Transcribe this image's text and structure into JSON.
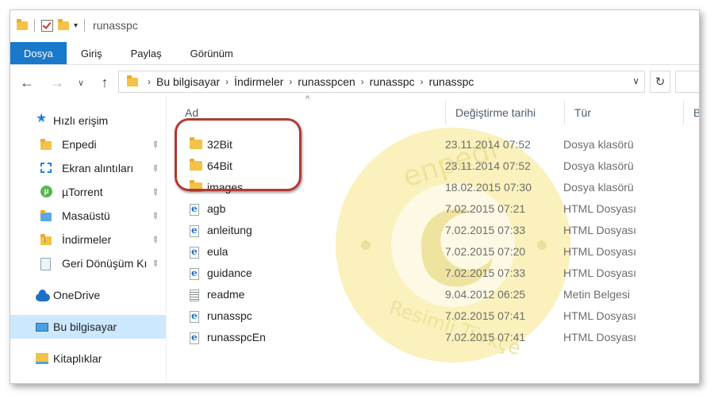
{
  "window": {
    "title": "runasspc",
    "quick_access": {
      "customize_caret": "▾"
    }
  },
  "ribbon": {
    "tabs": [
      {
        "label": "Dosya",
        "active": true
      },
      {
        "label": "Giriş"
      },
      {
        "label": "Paylaş"
      },
      {
        "label": "Görünüm"
      }
    ]
  },
  "address": {
    "back": "←",
    "forward": "→",
    "recent": "∨",
    "up": "↑",
    "breadcrumbs": [
      "Bu bilgisayar",
      "İndirmeler",
      "runasspcen",
      "runasspc",
      "runasspc"
    ],
    "separator": "›",
    "dropdown": "∨",
    "refresh": "↻"
  },
  "nav_pane": {
    "items": [
      {
        "label": "Hızlı erişim",
        "icon": "star-icon"
      },
      {
        "label": "Enpedi",
        "icon": "folder-icon",
        "pinned": true
      },
      {
        "label": "Ekran alıntıları",
        "icon": "snip-icon",
        "pinned": true
      },
      {
        "label": "µTorrent",
        "icon": "utorrent-icon",
        "pinned": true
      },
      {
        "label": "Masaüstü",
        "icon": "desktop-folder-icon",
        "pinned": true
      },
      {
        "label": "İndirmeler",
        "icon": "downloads-icon",
        "pinned": true
      },
      {
        "label": "Geri Dönüşüm Kı",
        "icon": "recycle-bin-icon",
        "pinned": true
      },
      {
        "label": "OneDrive",
        "icon": "cloud-icon"
      },
      {
        "label": "Bu bilgisayar",
        "icon": "pc-icon",
        "selected": true
      },
      {
        "label": "Kitaplıklar",
        "icon": "library-icon"
      }
    ],
    "pin_glyph": "📌",
    "utorrent_glyph": "µ"
  },
  "file_list": {
    "columns": [
      "Ad",
      "Değiştirme tarihi",
      "Tür",
      "Bo"
    ],
    "sort_caret": "^",
    "rows": [
      {
        "name": "32Bit",
        "date": "23.11.2014 07:52",
        "type": "Dosya klasörü",
        "icon": "folder-icon"
      },
      {
        "name": "64Bit",
        "date": "23.11.2014 07:52",
        "type": "Dosya klasörü",
        "icon": "folder-icon"
      },
      {
        "name": "images",
        "date": "18.02.2015 07:30",
        "type": "Dosya klasörü",
        "icon": "folder-icon"
      },
      {
        "name": "agb",
        "date": "7.02.2015 07:21",
        "type": "HTML Dosyası",
        "icon": "html-file-icon"
      },
      {
        "name": "anleitung",
        "date": "7.02.2015 07:33",
        "type": "HTML Dosyası",
        "icon": "html-file-icon"
      },
      {
        "name": "eula",
        "date": "7.02.2015 07:20",
        "type": "HTML Dosyası",
        "icon": "html-file-icon"
      },
      {
        "name": "guidance",
        "date": "7.02.2015 07:33",
        "type": "HTML Dosyası",
        "icon": "html-file-icon"
      },
      {
        "name": "readme",
        "date": "9.04.2012 06:25",
        "type": "Metin Belgesi",
        "icon": "text-file-icon"
      },
      {
        "name": "runasspc",
        "date": "7.02.2015 07:41",
        "type": "HTML Dosyası",
        "icon": "html-file-icon"
      },
      {
        "name": "runasspcEn",
        "date": "7.02.2015 07:41",
        "type": "HTML Dosyası",
        "icon": "html-file-icon"
      }
    ]
  },
  "watermark": {
    "top_text": "enpedi",
    "bottom_text": "Resimli Türkçe"
  },
  "colors": {
    "accent": "#1979ca",
    "highlight": "#b03a32",
    "selection": "#cce8ff",
    "watermark": "#f7e79a"
  }
}
